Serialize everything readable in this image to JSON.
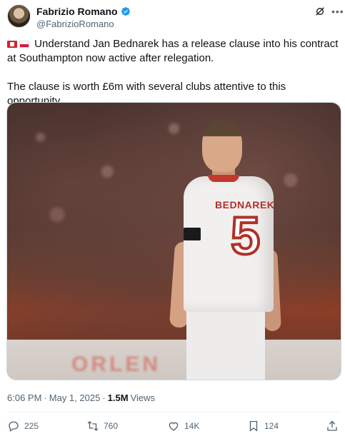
{
  "author": {
    "name": "Fabrizio Romano",
    "handle": "@FabrizioRomano"
  },
  "tweet": {
    "text_line1": "Understand Jan Bednarek has a release clause into his contract at Southampton now active after relegation.",
    "text_line2": "The clause is worth £6m with several clubs attentive to this opportunity."
  },
  "media": {
    "jersey_name": "BEDNAREK",
    "jersey_number": "5",
    "board_text": "ORLEN"
  },
  "meta": {
    "time": "6:06 PM",
    "sep1": "·",
    "date": "May 1, 2025",
    "sep2": "·",
    "views_count": "1.5M",
    "views_label": "Views"
  },
  "actions": {
    "replies": "225",
    "reposts": "760",
    "likes": "14K",
    "bookmarks": "124"
  },
  "colors": {
    "text": "#0f1419",
    "secondary": "#536471",
    "verified": "#1d9bf0"
  },
  "icons": [
    "verified-badge-icon",
    "grok-icon",
    "more-icon",
    "reply-icon",
    "repost-icon",
    "like-icon",
    "bookmark-icon",
    "share-icon"
  ]
}
